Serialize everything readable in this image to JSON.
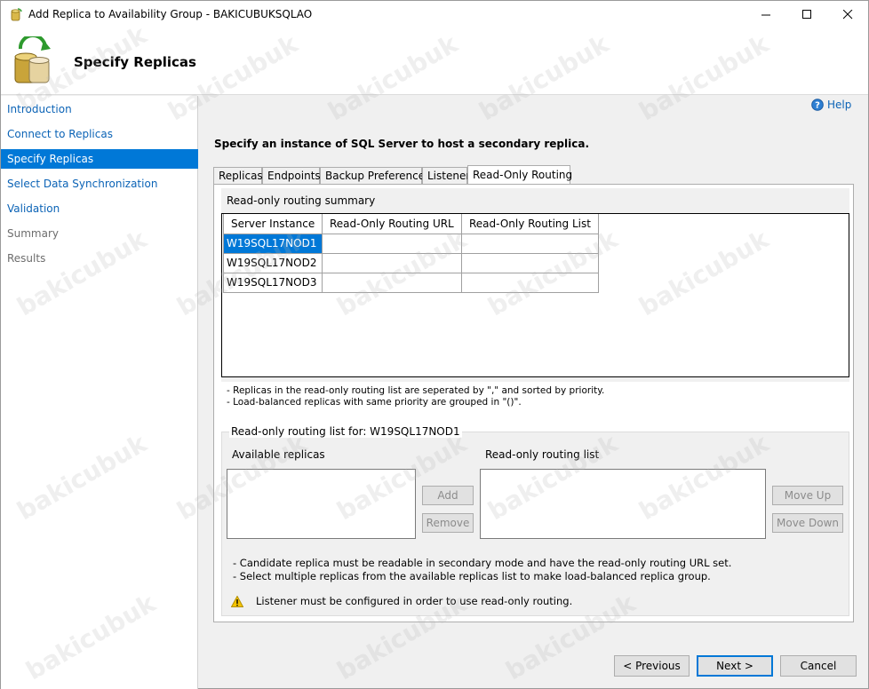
{
  "window": {
    "title": "Add Replica to Availability Group - BAKICUBUKSQLAO"
  },
  "header": {
    "title": "Specify Replicas"
  },
  "sidebar": {
    "items": [
      {
        "label": "Introduction",
        "state": "link"
      },
      {
        "label": "Connect to Replicas",
        "state": "link"
      },
      {
        "label": "Specify Replicas",
        "state": "active"
      },
      {
        "label": "Select Data Synchronization",
        "state": "link"
      },
      {
        "label": "Validation",
        "state": "link"
      },
      {
        "label": "Summary",
        "state": "disabled"
      },
      {
        "label": "Results",
        "state": "disabled"
      }
    ]
  },
  "help": {
    "label": "Help"
  },
  "main": {
    "instruction": "Specify an instance of SQL Server to host a secondary replica.",
    "tabs": [
      {
        "label": "Replicas"
      },
      {
        "label": "Endpoints"
      },
      {
        "label": "Backup Preferences"
      },
      {
        "label": "Listener"
      },
      {
        "label": "Read-Only Routing"
      }
    ],
    "active_tab": "Read-Only Routing",
    "summary": {
      "title": "Read-only routing summary",
      "columns": [
        "Server Instance",
        "Read-Only Routing URL",
        "Read-Only Routing List"
      ],
      "rows": [
        [
          "W19SQL17NOD1",
          "",
          ""
        ],
        [
          "W19SQL17NOD2",
          "",
          ""
        ],
        [
          "W19SQL17NOD3",
          "",
          ""
        ]
      ],
      "notes": [
        "- Replicas in the read-only routing list are seperated by \",\" and sorted by priority.",
        "- Load-balanced replicas with same priority are grouped in \"()\"."
      ]
    },
    "routing_list": {
      "title": "Read-only routing list for: W19SQL17NOD1",
      "available_label": "Available replicas",
      "routing_label": "Read-only routing list",
      "add_label": "Add",
      "remove_label": "Remove",
      "move_up_label": "Move Up",
      "move_down_label": "Move Down",
      "notes": [
        "- Candidate replica must be readable in secondary mode and have the read-only routing URL set.",
        "- Select multiple replicas from the available replicas list to make load-balanced replica group."
      ],
      "warning": "Listener must be configured in order to use read-only routing."
    }
  },
  "footer": {
    "previous_label": "< Previous",
    "next_label": "Next >",
    "cancel_label": "Cancel"
  },
  "watermark": "bakicubuk",
  "colors": {
    "accent": "#0078d7",
    "link": "#0b63b6",
    "warning": "#f5c400"
  }
}
